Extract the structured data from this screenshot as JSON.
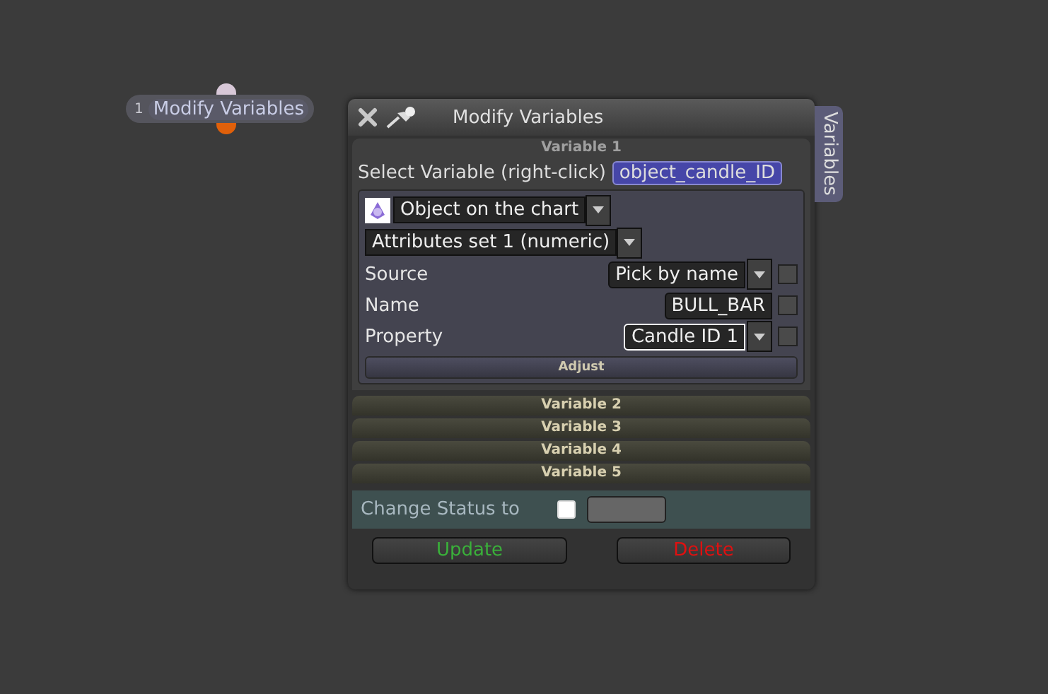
{
  "node": {
    "index": "1",
    "label": "Modify Variables"
  },
  "window": {
    "title": "Modify Variables",
    "side_tab": "Variables"
  },
  "variables": [
    {
      "title": "Variable 1",
      "expanded": true,
      "select_label": "Select Variable (right-click)",
      "selected_variable": "object_candle_ID",
      "object_type": "Object on the chart",
      "attribute_set": "Attributes set 1 (numeric)",
      "fields": [
        {
          "kind": "dropdown",
          "label": "Source",
          "value": "Pick by name",
          "focused": false,
          "checked": false
        },
        {
          "kind": "text",
          "label": "Name",
          "value": "BULL_BAR",
          "focused": false,
          "checked": false
        },
        {
          "kind": "dropdown",
          "label": "Property",
          "value": "Candle ID 1",
          "focused": true,
          "checked": false
        }
      ],
      "adjust_button": "Adjust"
    },
    {
      "title": "Variable 2",
      "expanded": false
    },
    {
      "title": "Variable 3",
      "expanded": false
    },
    {
      "title": "Variable 4",
      "expanded": false
    },
    {
      "title": "Variable 5",
      "expanded": false
    }
  ],
  "change_status": {
    "label": "Change Status to",
    "checked": false
  },
  "buttons": [
    {
      "label": "Update",
      "kind": "update"
    },
    {
      "label": "Delete",
      "kind": "delete"
    }
  ]
}
